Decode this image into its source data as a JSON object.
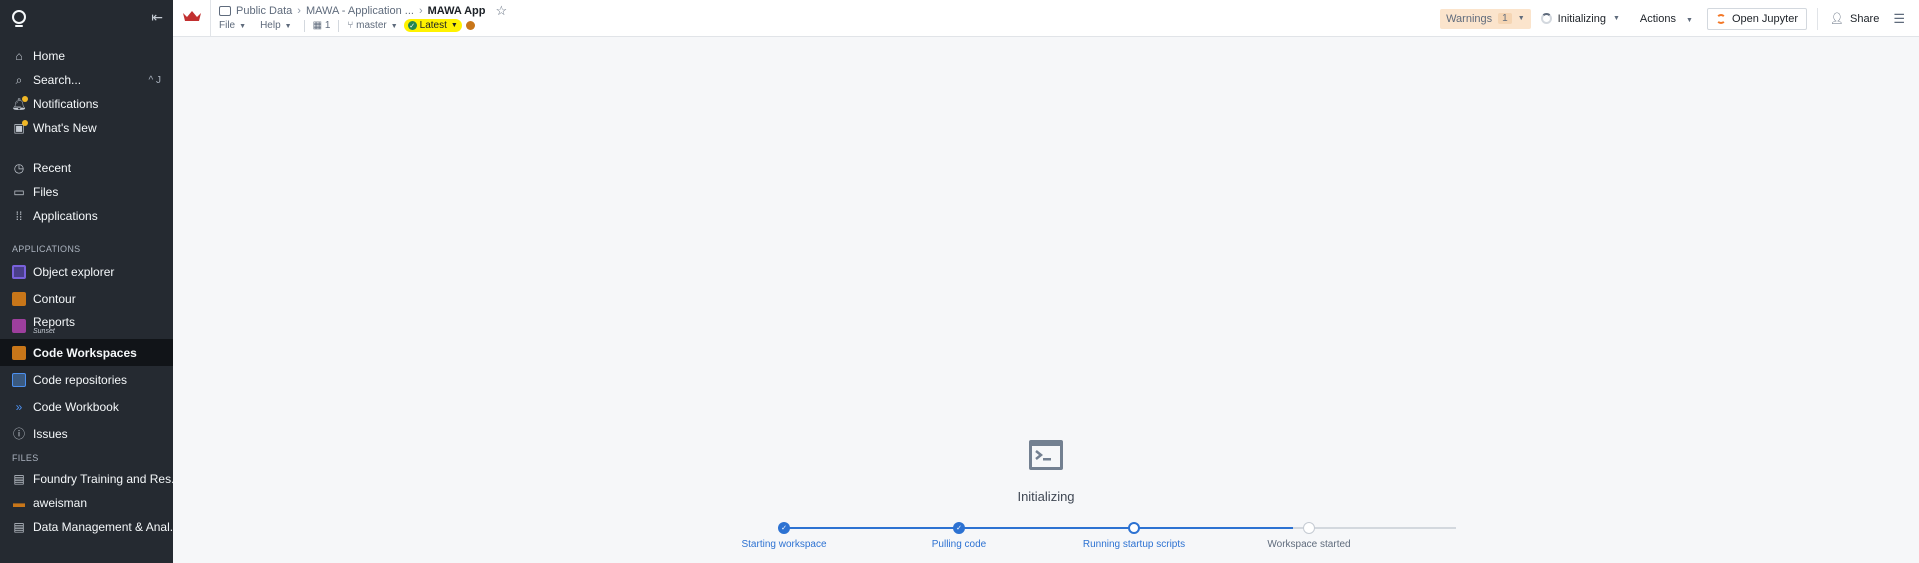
{
  "sidebar": {
    "items_top": [
      {
        "label": "Home",
        "icon": "home-icon"
      },
      {
        "label": "Search...",
        "icon": "search-icon",
        "shortcut": "^ J"
      },
      {
        "label": "Notifications",
        "icon": "bell-icon"
      },
      {
        "label": "What's New",
        "icon": "gift-icon"
      }
    ],
    "items_mid": [
      {
        "label": "Recent",
        "icon": "history-icon"
      },
      {
        "label": "Files",
        "icon": "folder-icon"
      },
      {
        "label": "Applications",
        "icon": "grid-icon"
      }
    ],
    "applications_title": "APPLICATIONS",
    "applications": [
      {
        "label": "Object explorer",
        "color": "#7961db"
      },
      {
        "label": "Contour",
        "color": "#c87619"
      },
      {
        "label": "Reports",
        "sub": "Sunset",
        "color": "#9d3f9d"
      },
      {
        "label": "Code Workspaces",
        "color": "#c87619"
      },
      {
        "label": "Code repositories",
        "color": "#4c90f0"
      },
      {
        "label": "Code Workbook",
        "color": "#2d72d2"
      },
      {
        "label": "Issues",
        "color": "#abb3bf"
      }
    ],
    "files_title": "FILES",
    "files": [
      {
        "label": "Foundry Training and Res..."
      },
      {
        "label": "aweisman"
      },
      {
        "label": "Data Management & Anal..."
      }
    ]
  },
  "topbar": {
    "breadcrumb": [
      "Public Data",
      "MAWA - Application ...",
      "MAWA App"
    ],
    "menu": {
      "file": "File",
      "help": "Help",
      "count": "1",
      "branch": "master",
      "latest": "Latest"
    },
    "warnings_label": "Warnings",
    "warnings_count": "1",
    "status": "Initializing",
    "actions": "Actions",
    "open_jupyter": "Open Jupyter",
    "share": "Share"
  },
  "main": {
    "title": "Initializing",
    "steps": [
      {
        "label": "Starting workspace",
        "state": "done"
      },
      {
        "label": "Pulling code",
        "state": "done"
      },
      {
        "label": "Running startup scripts",
        "state": "active"
      },
      {
        "label": "Workspace started",
        "state": "pending"
      }
    ],
    "accent": "#2d72d2"
  }
}
